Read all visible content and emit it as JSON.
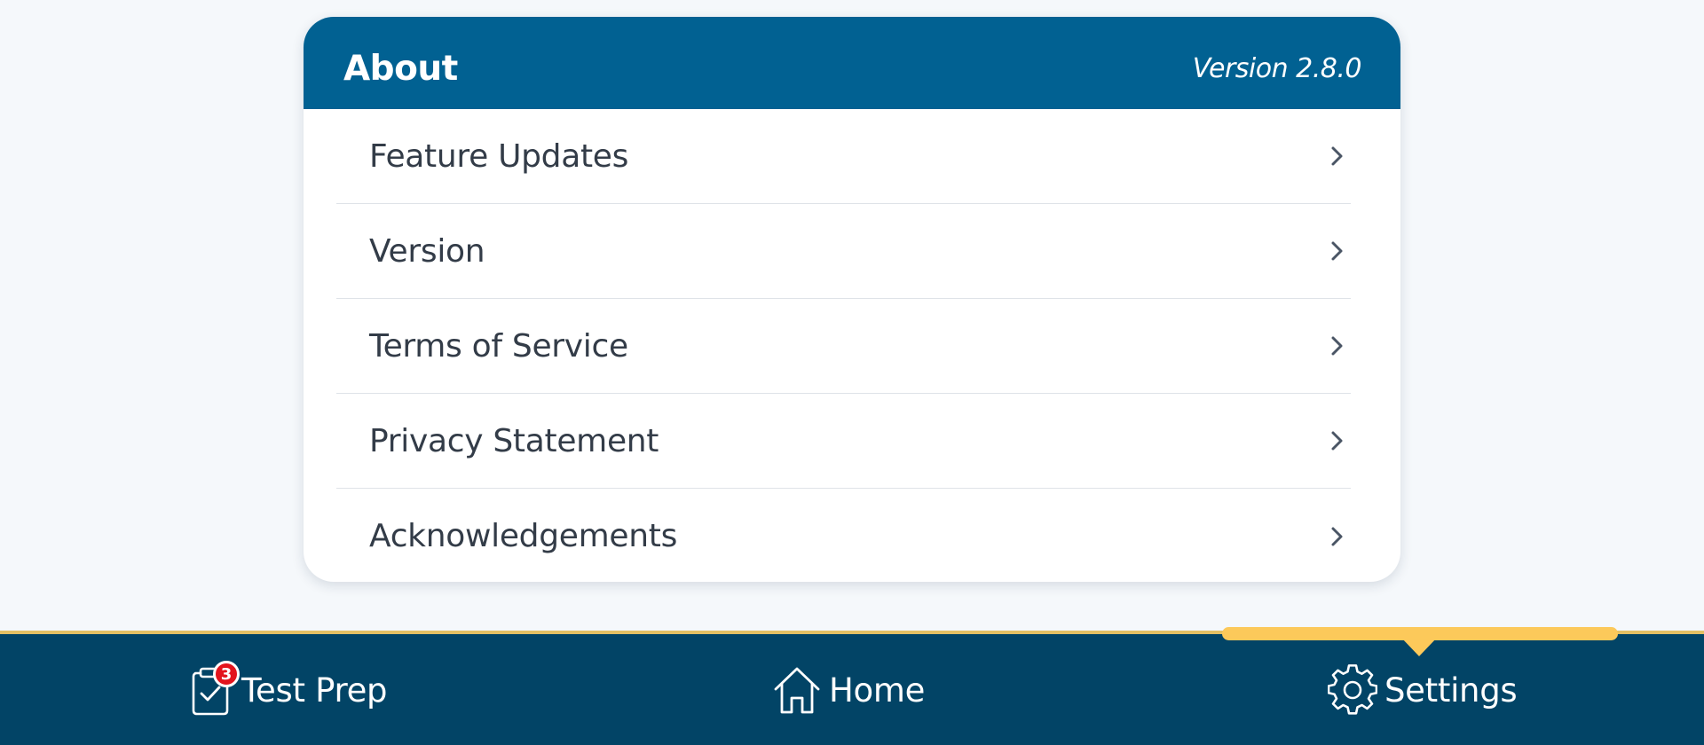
{
  "about": {
    "title": "About",
    "version_text": "Version 2.8.0",
    "items": [
      {
        "label": "Feature Updates"
      },
      {
        "label": "Version"
      },
      {
        "label": "Terms of Service"
      },
      {
        "label": "Privacy Statement"
      },
      {
        "label": "Acknowledgements"
      }
    ]
  },
  "nav": {
    "items": [
      {
        "label": "Test Prep",
        "icon": "clipboard-check-icon",
        "badge": "3"
      },
      {
        "label": "Home",
        "icon": "home-icon"
      },
      {
        "label": "Settings",
        "icon": "gear-icon",
        "active": true
      }
    ]
  },
  "colors": {
    "header_blue": "#016192",
    "nav_blue": "#024466",
    "active_indicator": "#fcc95a",
    "badge_red": "#e3141d"
  }
}
